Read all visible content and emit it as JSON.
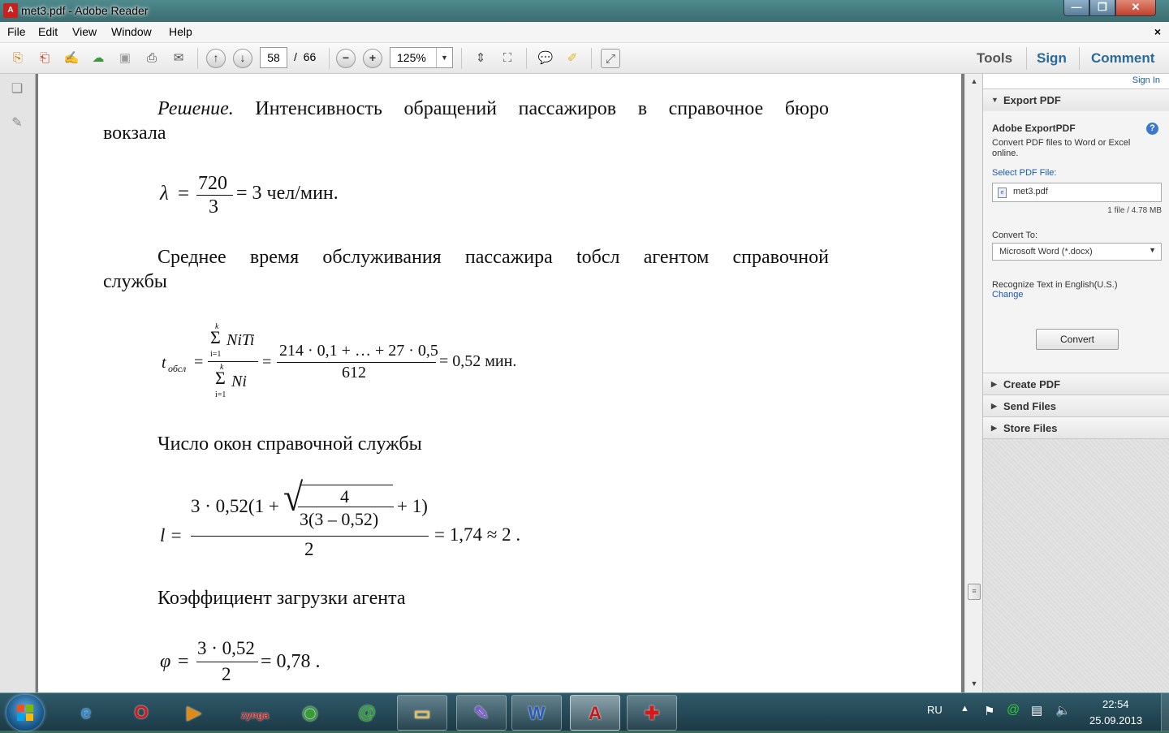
{
  "window": {
    "title": "met3.pdf - Adobe Reader",
    "app_icon": "pdf-icon"
  },
  "menu": {
    "items": [
      "File",
      "Edit",
      "View",
      "Window",
      "Help"
    ],
    "close_doc": "×"
  },
  "toolbar": {
    "page_current": "58",
    "page_separator": "/",
    "page_total": "66",
    "zoom": "125%",
    "tabs": {
      "tools": "Tools",
      "sign": "Sign",
      "comment": "Comment"
    }
  },
  "document": {
    "p1_parts": [
      "Решение.",
      "Интенсивность",
      "обращений",
      "пассажиров",
      "в",
      "справочное",
      "бюро"
    ],
    "p1_line2": "вокзала",
    "eq1": {
      "lhs": "λ",
      "eq": "=",
      "num": "720",
      "den": "3",
      "rhs": "= 3 чел/мин."
    },
    "p2_parts": [
      "Среднее",
      "время",
      "обслуживания",
      "пассажира",
      "tобсл",
      "агентом",
      "справочной"
    ],
    "p2_line2": "службы",
    "eq2": {
      "lhs": "t",
      "lhs_sub": "обсл",
      "eq": "=",
      "sum_top": "k",
      "sum": "Σ",
      "sum_bot": "i=1",
      "term_top": "NiTi",
      "term_bot": "Ni",
      "mid_eq": "=",
      "num": "214 · 0,1 + … + 27 · 0,5",
      "den": "612",
      "rhs": "= 0,52 мин."
    },
    "p3": "Число окон справочной службы",
    "eq3": {
      "lhs": "l =",
      "num_a": "3 · 0,52(1 +",
      "sqrt": "√",
      "inner_num": "4",
      "inner_den": "3(3 – 0,52)",
      "num_b": "+ 1)",
      "den": "2",
      "rhs": "= 1,74 ≈ 2 ."
    },
    "p4": "Коэффициент загрузки агента",
    "eq4": {
      "lhs": "φ",
      "eq": "=",
      "num": "3 · 0,52",
      "den": "2",
      "rhs": "= 0,78 ."
    }
  },
  "right_panel": {
    "sign_in": "Sign In",
    "export_section": "Export PDF",
    "service_title": "Adobe ExportPDF",
    "service_desc1": "Convert PDF files to Word or Excel",
    "service_desc2": "online.",
    "select_label": "Select PDF File:",
    "file_name": "met3.pdf",
    "file_info": "1 file / 4.78 MB",
    "convert_to_label": "Convert To:",
    "convert_to_value": "Microsoft Word (*.docx)",
    "recognize_text": "Recognize Text in English(U.S.)",
    "change_link": "Change",
    "convert_button": "Convert",
    "sections": [
      "Create PDF",
      "Send Files",
      "Store Files"
    ]
  },
  "taskbar": {
    "apps": [
      {
        "name": "internet-explorer-icon",
        "glyph": "e",
        "color": "#2a8ad8"
      },
      {
        "name": "opera-icon",
        "glyph": "O",
        "color": "#d81818"
      },
      {
        "name": "media-player-icon",
        "glyph": "▶",
        "color": "#e08a1a"
      },
      {
        "name": "zynga-icon",
        "glyph": "zynga",
        "color": "#c81818"
      },
      {
        "name": "chrome-icon",
        "glyph": "◉",
        "color": "#3a9a3a"
      },
      {
        "name": "mail-agent-icon",
        "glyph": "@",
        "color": "#18a818"
      },
      {
        "name": "folder-icon",
        "glyph": "▭",
        "color": "#e8c050"
      },
      {
        "name": "notes-icon",
        "glyph": "✎",
        "color": "#7a5ac8"
      },
      {
        "name": "word-icon",
        "glyph": "W",
        "color": "#2a5ab8"
      },
      {
        "name": "adobe-reader-icon",
        "glyph": "A",
        "color": "#c81818"
      },
      {
        "name": "red-app-icon",
        "glyph": "✚",
        "color": "#d81818"
      }
    ],
    "lang": "RU",
    "time": "22:54",
    "date": "25.09.2013"
  }
}
